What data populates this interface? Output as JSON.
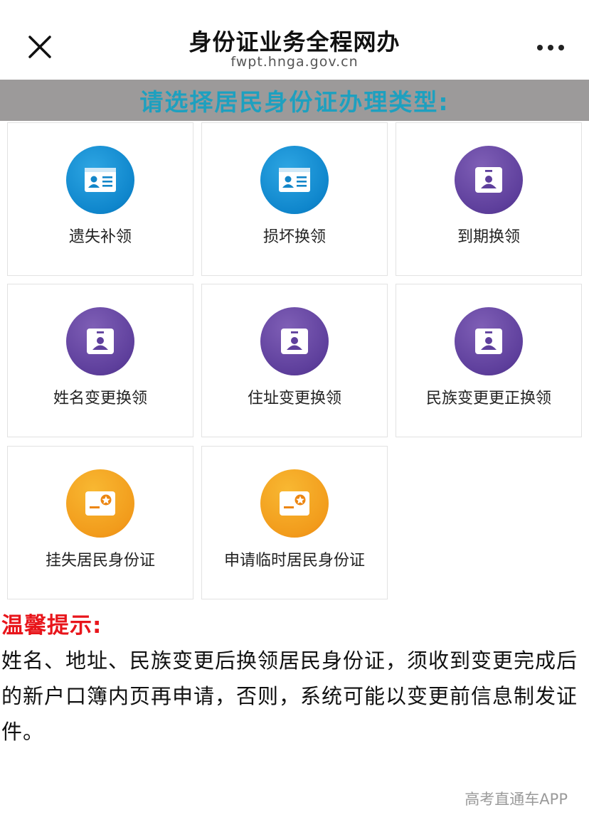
{
  "header": {
    "close_icon": "close-icon",
    "title": "身份证业务全程网办",
    "domain": "fwpt.hnga.gov.cn",
    "more_icon": "more-dots-icon"
  },
  "banner": {
    "text": "请选择居民身份证办理类型:",
    "background": "#9c9a9a",
    "text_color": "#1ea0bf"
  },
  "services": [
    {
      "label": "遗失补领",
      "icon": "id-card-icon",
      "color": "blue"
    },
    {
      "label": "损坏换领",
      "icon": "id-card-icon",
      "color": "blue"
    },
    {
      "label": "到期换领",
      "icon": "badge-icon",
      "color": "purple"
    },
    {
      "label": "姓名变更换领",
      "icon": "badge-icon",
      "color": "purple"
    },
    {
      "label": "住址变更换领",
      "icon": "badge-icon",
      "color": "purple"
    },
    {
      "label": "民族变更更正换领",
      "icon": "badge-icon",
      "color": "purple"
    },
    {
      "label": "挂失居民身份证",
      "icon": "card-star-icon",
      "color": "orange"
    },
    {
      "label": "申请临时居民身份证",
      "icon": "card-star-icon",
      "color": "orange"
    }
  ],
  "tip": {
    "title": "温馨提示:",
    "body": "姓名、地址、民族变更后换领居民身份证，须收到变更完成后的新户口簿内页再申请，否则，系统可能以变更前信息制发证件。",
    "title_color": "#e8151b"
  },
  "watermark": "高考直通车APP"
}
